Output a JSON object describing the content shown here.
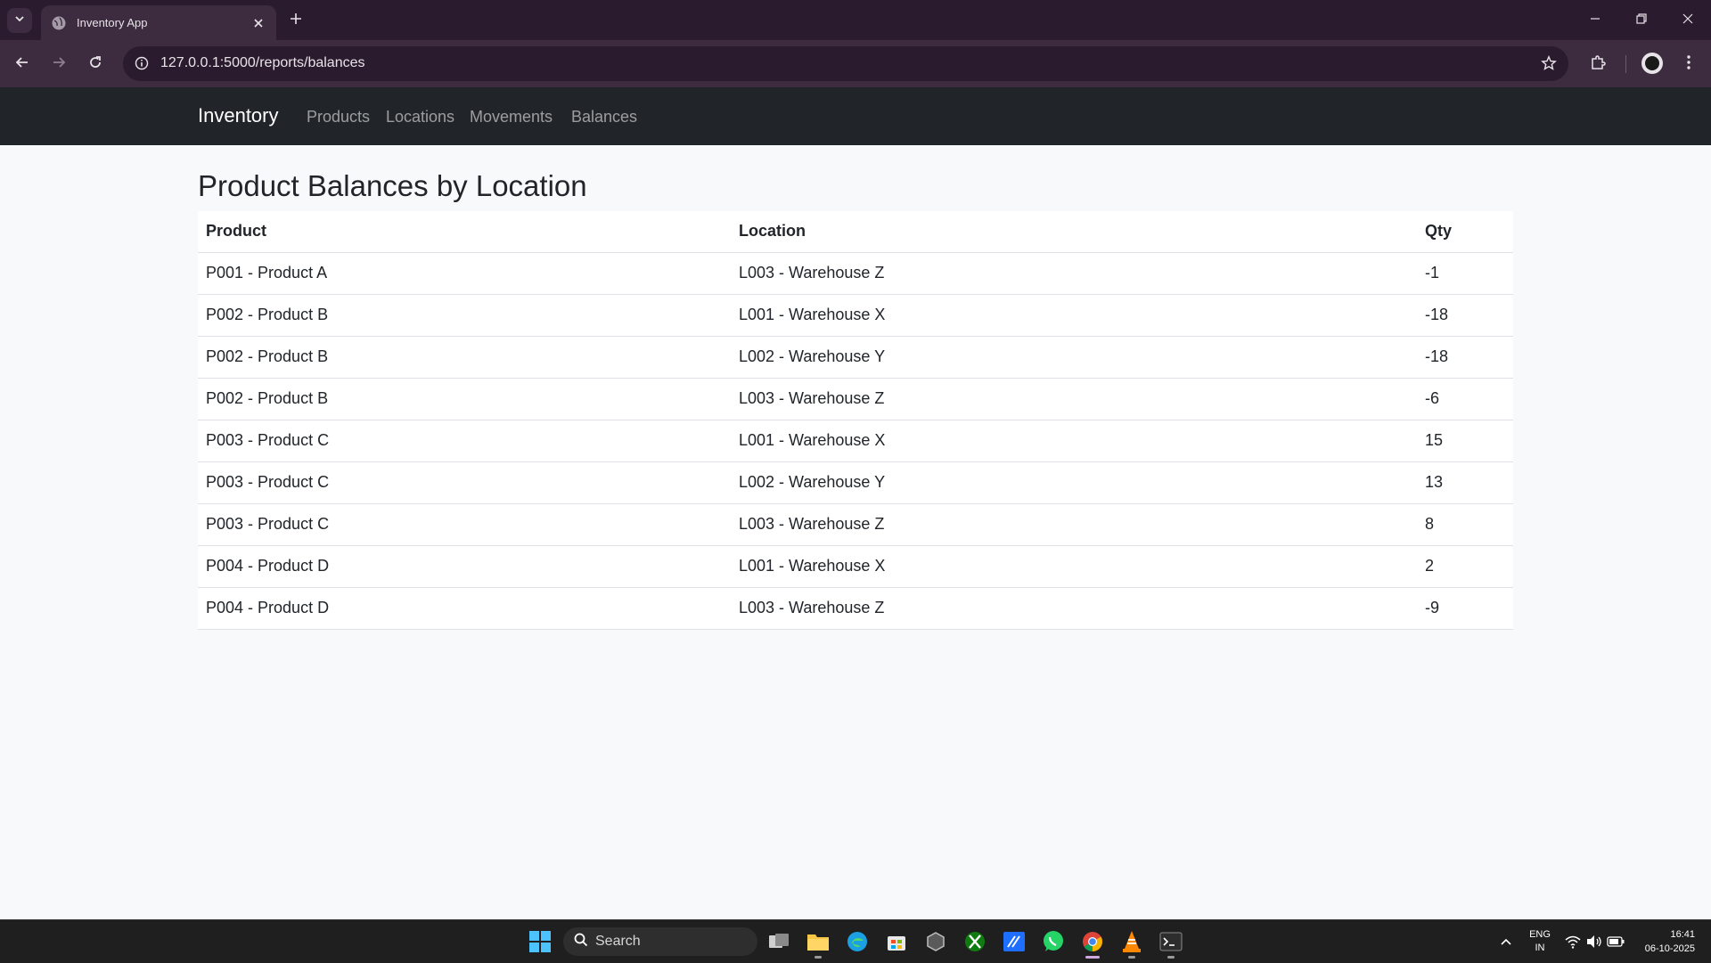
{
  "browser": {
    "tab_title": "Inventory App",
    "url": "127.0.0.1:5000/reports/balances"
  },
  "navbar": {
    "brand": "Inventory",
    "links": [
      "Products",
      "Locations",
      "Movements",
      "Balances"
    ]
  },
  "page": {
    "title": "Product Balances by Location",
    "table": {
      "headers": [
        "Product",
        "Location",
        "Qty"
      ],
      "rows": [
        [
          "P001 - Product A",
          "L003 - Warehouse Z",
          "-1"
        ],
        [
          "P002 - Product B",
          "L001 - Warehouse X",
          "-18"
        ],
        [
          "P002 - Product B",
          "L002 - Warehouse Y",
          "-18"
        ],
        [
          "P002 - Product B",
          "L003 - Warehouse Z",
          "-6"
        ],
        [
          "P003 - Product C",
          "L001 - Warehouse X",
          "15"
        ],
        [
          "P003 - Product C",
          "L002 - Warehouse Y",
          "13"
        ],
        [
          "P003 - Product C",
          "L003 - Warehouse Z",
          "8"
        ],
        [
          "P004 - Product D",
          "L001 - Warehouse X",
          "2"
        ],
        [
          "P004 - Product D",
          "L003 - Warehouse Z",
          "-9"
        ]
      ]
    }
  },
  "taskbar": {
    "search_label": "Search",
    "lang": "ENG",
    "region": "IN",
    "time": "16:41",
    "date": "06-10-2025",
    "icons": [
      "windows-start-icon",
      "search-icon",
      "task-view-icon",
      "file-explorer-icon",
      "edge-icon",
      "store-icon",
      "app-icon",
      "xbox-icon",
      "app-icon",
      "whatsapp-icon",
      "chrome-icon",
      "vlc-icon",
      "terminal-icon"
    ]
  },
  "colors": {
    "navbar_bg": "#212529",
    "browser_frame": "#2b1b2e",
    "toolbar": "#3d2b3f",
    "page_bg": "#f8f9fa"
  }
}
